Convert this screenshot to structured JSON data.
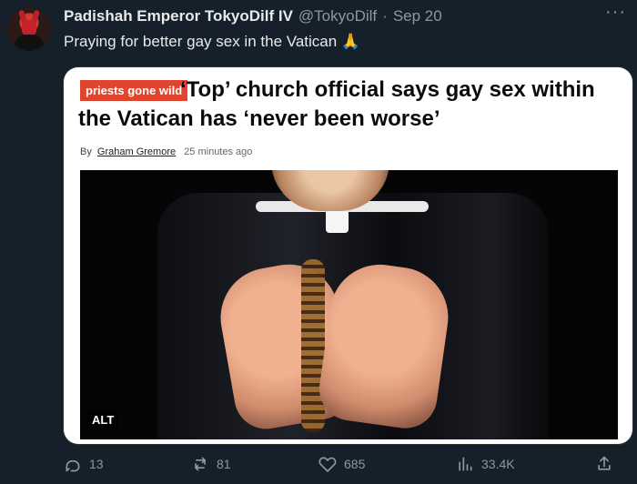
{
  "tweet": {
    "display_name": "Padishah Emperor TokyoDilf IV",
    "handle": "@TokyoDilf",
    "separator": "·",
    "date": "Sep 20",
    "text": "Praying for better gay sex in the Vatican 🙏",
    "more_label": "···"
  },
  "card": {
    "tag": "priests gone wild",
    "headline": "‘Top’ church official says gay sex within the Vatican has ‘never been worse’",
    "byline_prefix": "By",
    "author": "Graham Gremore",
    "time": "25 minutes ago",
    "alt_label": "ALT"
  },
  "actions": {
    "replies": "13",
    "reposts": "81",
    "likes": "685",
    "views": "33.4K"
  },
  "colors": {
    "background": "#15202b",
    "secondary_text": "#8b98a5",
    "tag": "#e0462f"
  }
}
